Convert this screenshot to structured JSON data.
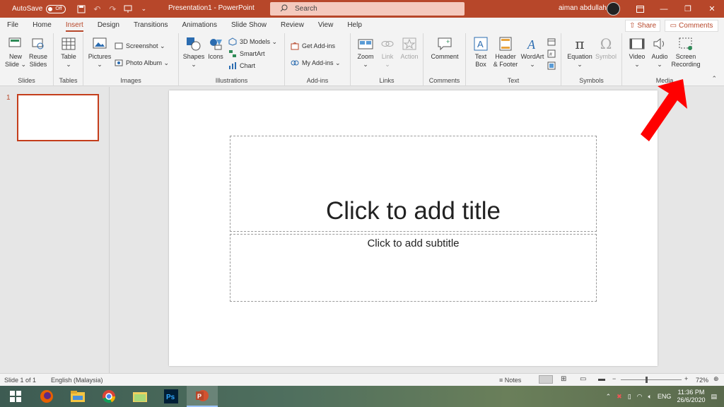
{
  "titlebar": {
    "autosave_label": "AutoSave",
    "autosave_state": "Off",
    "title": "Presentation1  -  PowerPoint",
    "search_placeholder": "Search",
    "user_name": "aiman abdullah"
  },
  "tabs": [
    "File",
    "Home",
    "Insert",
    "Design",
    "Transitions",
    "Animations",
    "Slide Show",
    "Review",
    "View",
    "Help"
  ],
  "active_tab": "Insert",
  "share_label": "Share",
  "comments_label": "Comments",
  "ribbon": {
    "slides": {
      "label": "Slides",
      "new_slide": "New\nSlide ⌄",
      "reuse_slides": "Reuse\nSlides"
    },
    "tables": {
      "label": "Tables",
      "table": "Table\n⌄"
    },
    "images": {
      "label": "Images",
      "pictures": "Pictures\n⌄",
      "screenshot": "Screenshot ⌄",
      "photo_album": "Photo Album  ⌄"
    },
    "illustrations": {
      "label": "Illustrations",
      "shapes": "Shapes\n⌄",
      "icons": "Icons",
      "models3d": "3D Models  ⌄",
      "smartart": "SmartArt",
      "chart": "Chart"
    },
    "addins": {
      "label": "Add-ins",
      "get_addins": "Get Add-ins",
      "my_addins": "My Add-ins  ⌄"
    },
    "links": {
      "label": "Links",
      "zoom": "Zoom\n⌄",
      "link": "Link\n⌄",
      "action": "Action"
    },
    "comments": {
      "label": "Comments",
      "comment": "Comment"
    },
    "text": {
      "label": "Text",
      "text_box": "Text\nBox",
      "header_footer": "Header\n& Footer",
      "wordart": "WordArt\n⌄"
    },
    "symbols": {
      "label": "Symbols",
      "equation": "Equation\n⌄",
      "symbol": "Symbol"
    },
    "media": {
      "label": "Media",
      "video": "Video\n⌄",
      "audio": "Audio\n⌄",
      "screen_recording": "Screen\nRecording"
    }
  },
  "thumbnails": {
    "slide_number": "1"
  },
  "slide": {
    "title_placeholder": "Click to add title",
    "subtitle_placeholder": "Click to add subtitle"
  },
  "statusbar": {
    "slide_info": "Slide 1 of 1",
    "language": "English (Malaysia)",
    "notes": "Notes",
    "zoom": "72%"
  },
  "taskbar": {
    "apps": [
      "windows-start",
      "firefox",
      "file-explorer",
      "chrome",
      "folder",
      "photoshop",
      "powerpoint"
    ],
    "language": "ENG",
    "time": "11:36 PM",
    "date": "26/6/2020"
  },
  "colors": {
    "accent": "#b7472a",
    "arrow": "#ff0000"
  }
}
